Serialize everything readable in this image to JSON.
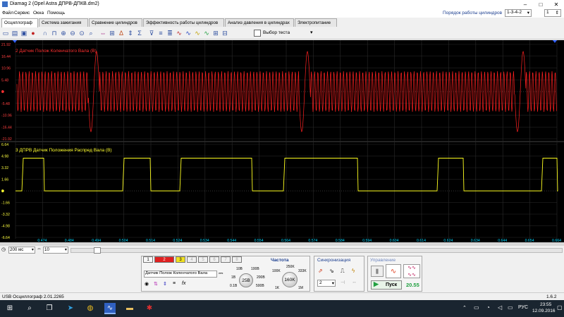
{
  "window": {
    "title": "Diamag 2 (Opel Astra ДПРВ-ДПКВ.dm2)",
    "minimize": "–",
    "maximize": "□",
    "close": "✕"
  },
  "menu": [
    "Файл",
    "Сервис",
    "Окна",
    "Помощь"
  ],
  "cylinder_order": {
    "label": "Порядок работы цилиндров",
    "value": "1-3-4-2",
    "count": "1"
  },
  "tabs": [
    "Осциллограф",
    "Система зажигания",
    "Сравнение цилиндров",
    "Эффективность работы цилиндров",
    "Анализ давления в цилиндрах",
    "Электропитание"
  ],
  "toolbar": {
    "test_select": "Выбор теста"
  },
  "channel1": {
    "label": "2 Датчик Полож Коленчатого Вала (В)",
    "color": "#ff2020",
    "y_ticks": [
      "21.92",
      "16.44",
      "10.96",
      "5.48",
      "0",
      "-5.48",
      "-10.96",
      "-16.44",
      "-21.92"
    ]
  },
  "channel2": {
    "label": "3 ДПРВ Датчик Положения Распред Вала (В)",
    "color": "#ffff20",
    "y_ticks": [
      "6.64",
      "4.98",
      "3.32",
      "1.66",
      "0",
      "-1.66",
      "-3.32",
      "-4.98",
      "-6.64"
    ]
  },
  "x_ticks": [
    "0.474",
    "0.484",
    "0.494",
    "0.504",
    "0.514",
    "0.524",
    "0.534",
    "0.544",
    "0.554",
    "0.564",
    "0.574",
    "0.584",
    "0.594",
    "0.604",
    "0.614",
    "0.624",
    "0.634",
    "0.644",
    "0.654",
    "0.664"
  ],
  "scroll": {
    "timebase": "200 мс",
    "count": "10"
  },
  "controls": {
    "channel_buttons": [
      "1",
      "2",
      "3",
      "4",
      "5",
      "6",
      "7",
      "8"
    ],
    "sensor_select": "Датчик Полож Коленчатого Вала",
    "volt_knob": "25В",
    "volt_marks": [
      "10В",
      "100В",
      "1В",
      "200В",
      "0.1В",
      "500В"
    ],
    "freq_label": "Частота",
    "freq_knob": "160K",
    "freq_marks": [
      "250K",
      "100K",
      "333K",
      "1K",
      "1M"
    ],
    "sync_label": "Синхронизация",
    "sync_value": "2",
    "control_label": "Управление",
    "start_button": "Пуск",
    "fps": "20.55"
  },
  "status": {
    "left": "USB Осциллограф  2.01.2265",
    "version": "1.6.2"
  },
  "taskbar": {
    "lang": "РУС",
    "time": "23:55",
    "date": "12.09.2016"
  }
}
